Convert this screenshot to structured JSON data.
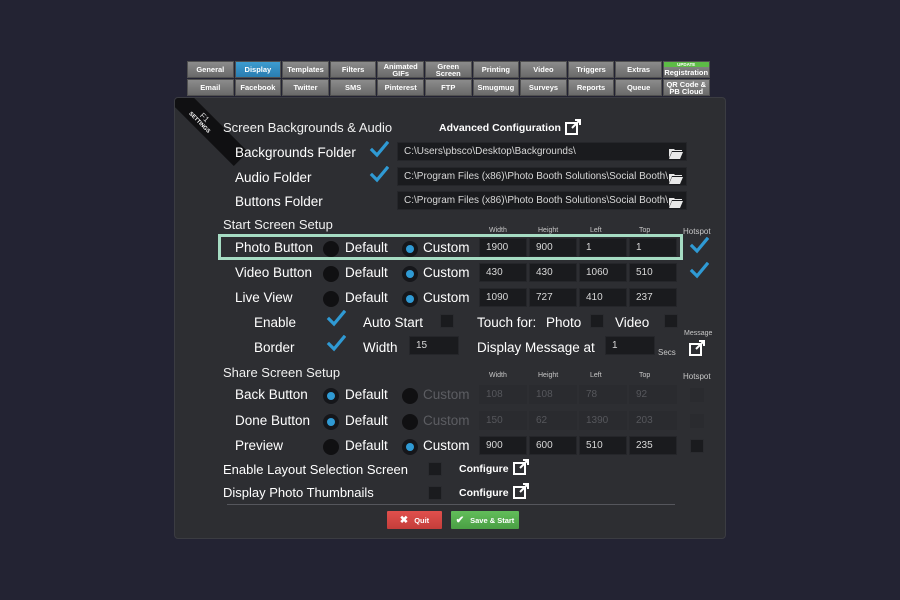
{
  "tabs_row1": [
    {
      "label": "General"
    },
    {
      "label": "Display",
      "active": true
    },
    {
      "label": "Templates"
    },
    {
      "label": "Filters"
    },
    {
      "label": "Animated GIFs"
    },
    {
      "label": "Green Screen"
    },
    {
      "label": "Printing"
    },
    {
      "label": "Video"
    },
    {
      "label": "Triggers"
    },
    {
      "label": "Extras"
    },
    {
      "label": "Registration",
      "badge": "UPDATE"
    }
  ],
  "tabs_row2": [
    {
      "label": "Email"
    },
    {
      "label": "Facebook"
    },
    {
      "label": "Twitter"
    },
    {
      "label": "SMS"
    },
    {
      "label": "Pinterest"
    },
    {
      "label": "FTP"
    },
    {
      "label": "Smugmug"
    },
    {
      "label": "Surveys"
    },
    {
      "label": "Reports"
    },
    {
      "label": "Queue"
    },
    {
      "label": "QR Code & PB Cloud"
    }
  ],
  "ribbon": {
    "key": "F1",
    "label": "SETTINGS"
  },
  "backgrounds_audio": {
    "heading": "Screen Backgrounds & Audio",
    "advanced_label": "Advanced Configuration",
    "rows": [
      {
        "label": "Backgrounds Folder",
        "checked": true,
        "path": "C:\\Users\\pbsco\\Desktop\\Backgrounds\\"
      },
      {
        "label": "Audio Folder",
        "checked": true,
        "path": "C:\\Program Files (x86)\\Photo Booth Solutions\\Social Booth\\"
      },
      {
        "label": "Buttons Folder",
        "checked": false,
        "path": "C:\\Program Files (x86)\\Photo Booth Solutions\\Social Booth\\"
      }
    ]
  },
  "start_screen": {
    "heading": "Start Screen Setup",
    "columns": [
      "Width",
      "Height",
      "Left",
      "Top",
      "Hotspot"
    ],
    "default_label": "Default",
    "custom_label": "Custom",
    "rows": [
      {
        "label": "Photo Button",
        "selected": "Custom",
        "width": "1900",
        "height": "900",
        "left": "1",
        "top": "1",
        "hotspot": true
      },
      {
        "label": "Video Button",
        "selected": "Custom",
        "width": "430",
        "height": "430",
        "left": "1060",
        "top": "510",
        "hotspot": true
      },
      {
        "label": "Live View",
        "selected": "Custom",
        "width": "1090",
        "height": "727",
        "left": "410",
        "top": "237"
      }
    ],
    "enable_label": "Enable",
    "enable_checked": true,
    "auto_start_label": "Auto Start",
    "auto_start_checked": false,
    "touch_for_label": "Touch  for:",
    "touch_photo_label": "Photo",
    "touch_photo_checked": false,
    "touch_video_label": "Video",
    "touch_video_checked": false,
    "border_label": "Border",
    "border_checked": true,
    "width_label": "Width",
    "width_value": "15",
    "display_message_label": "Display Message at",
    "display_message_value": "1",
    "secs_label": "Secs",
    "message_label": "Message"
  },
  "share_screen": {
    "heading": "Share Screen Setup",
    "columns": [
      "Width",
      "Height",
      "Left",
      "Top",
      "Hotspot"
    ],
    "default_label": "Default",
    "custom_label": "Custom",
    "rows": [
      {
        "label": "Back Button",
        "selected": "Default",
        "width": "108",
        "height": "108",
        "left": "78",
        "top": "92"
      },
      {
        "label": "Done Button",
        "selected": "Default",
        "width": "150",
        "height": "62",
        "left": "1390",
        "top": "203"
      },
      {
        "label": "Preview",
        "selected": "Custom",
        "width": "900",
        "height": "600",
        "left": "510",
        "top": "235"
      }
    ]
  },
  "options": {
    "layout_label": "Enable Layout Selection Screen",
    "thumbnails_label": "Display Photo Thumbnails",
    "configure_label": "Configure"
  },
  "buttons": {
    "quit": "Quit",
    "save": "Save & Start"
  },
  "colors": {
    "accent": "#2f9ad4",
    "highlight": "#a6dcc3",
    "quit": "#d3433f",
    "save": "#56ad4f"
  }
}
